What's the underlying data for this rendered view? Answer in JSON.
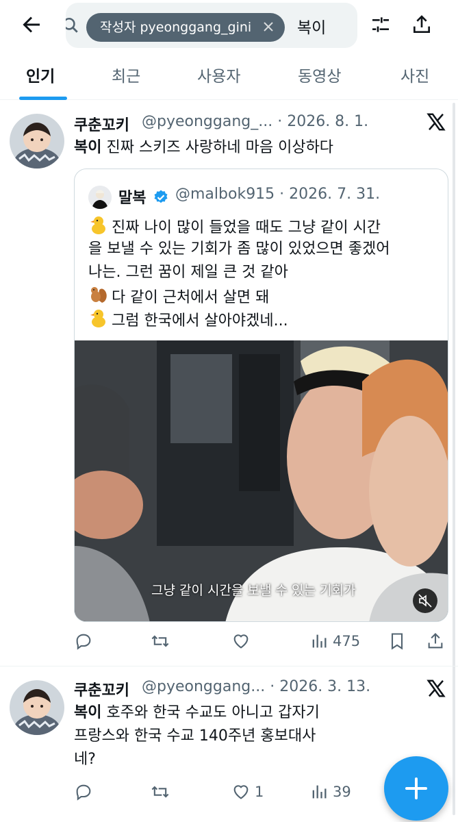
{
  "search": {
    "chip_label": "작성자 pyeonggang_gini",
    "query": "복이"
  },
  "tabs": [
    {
      "label": "인기"
    },
    {
      "label": "최근"
    },
    {
      "label": "사용자"
    },
    {
      "label": "동영상"
    },
    {
      "label": "사진"
    }
  ],
  "tweets": [
    {
      "name": "쿠춘꼬키",
      "handle_time": "@pyeonggang_... · 2026. 8. 1.",
      "highlight": "복이",
      "text": " 진짜 스키즈 사랑하네 마음 이상하다",
      "quote": {
        "name": "말복",
        "handle_time": "@malbok915 · 2026. 7. 31.",
        "lines": [
          "진짜 나이 많이 들었을 때도 그냥 같이 시간",
          "을 보낼 수 있는 기회가 좀 많이 있었으면 좋겠어",
          "나는. 그런 꿈이 제일 큰 것 같아",
          "다 같이 근처에서 살면 돼",
          "그럼 한국에서 살아야겠네..."
        ],
        "video_caption": "그냥 같이 시간을 보낼 수 있는 기회가"
      },
      "stats": {
        "replies": "",
        "retweets": "",
        "likes": "",
        "views": "475"
      }
    },
    {
      "name": "쿠춘꼬키",
      "handle_time": "@pyeonggang... · 2026. 3. 13.",
      "highlight": "복이",
      "text_lines": [
        " 호주와 한국 수교도 아니고 갑자기",
        "프랑스와 한국 수교 140주년 홍보대사",
        "네?"
      ],
      "stats": {
        "replies": "",
        "retweets": "",
        "likes": "1",
        "views": "39"
      }
    }
  ],
  "colors": {
    "accent": "#1d9bf0",
    "text": "#0f1419",
    "secondary": "#536471",
    "chip": "#536471"
  },
  "icons": [
    "back-arrow-icon",
    "search-icon",
    "filter-icon",
    "share-icon",
    "x-logo-icon",
    "verified-icon",
    "reply-icon",
    "retweet-icon",
    "like-icon",
    "views-icon",
    "bookmark-icon",
    "mute-icon",
    "compose-plus-icon"
  ]
}
